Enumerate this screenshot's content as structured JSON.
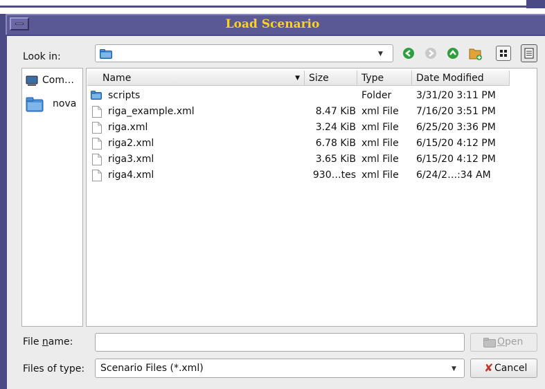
{
  "window": {
    "title": "Load Scenario"
  },
  "look_in": {
    "label": "Look in:",
    "value": ""
  },
  "toolbar": {
    "icons": [
      "back-icon",
      "forward-icon",
      "up-folder-icon",
      "new-folder-icon",
      "list-view-icon",
      "details-view-icon"
    ]
  },
  "sidebar": {
    "items": [
      {
        "label": "Com…"
      },
      {
        "label": "nova"
      }
    ]
  },
  "table": {
    "columns": [
      "Name",
      "Size",
      "Type",
      "Date Modified"
    ],
    "rows": [
      {
        "name": "scripts",
        "size": "",
        "type": "Folder",
        "date": "3/31/20 3:11 PM",
        "kind": "folder"
      },
      {
        "name": "riga_example.xml",
        "size": "8.47 KiB",
        "type": "xml File",
        "date": "7/16/20 3:51 PM",
        "kind": "file"
      },
      {
        "name": "riga.xml",
        "size": "3.24 KiB",
        "type": "xml File",
        "date": "6/25/20 3:36 PM",
        "kind": "file"
      },
      {
        "name": "riga2.xml",
        "size": "6.78 KiB",
        "type": "xml File",
        "date": "6/15/20 4:12 PM",
        "kind": "file"
      },
      {
        "name": "riga3.xml",
        "size": "3.65 KiB",
        "type": "xml File",
        "date": "6/15/20 4:12 PM",
        "kind": "file"
      },
      {
        "name": "riga4.xml",
        "size": "930…tes",
        "type": "xml File",
        "date": "6/24/2…:34 AM",
        "kind": "file"
      }
    ]
  },
  "file_name": {
    "label_pre": "File ",
    "label_u": "n",
    "label_post": "ame:",
    "value": ""
  },
  "file_type": {
    "label": "Files of type:",
    "value": "Scenario Files (*.xml)"
  },
  "buttons": {
    "open_u": "O",
    "open_rest": "pen",
    "cancel": "Cancel"
  },
  "colors": {
    "title_text": "#ffd21f",
    "title_bar": "#5b5896",
    "folder": "#4a90d9",
    "accent_green": "#2e9e3e"
  }
}
